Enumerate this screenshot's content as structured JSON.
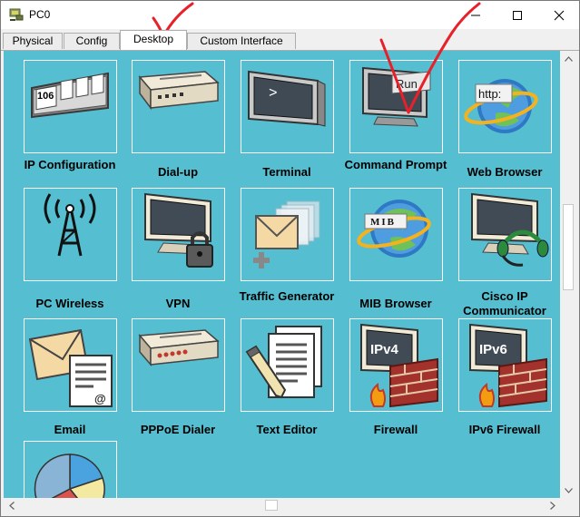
{
  "window": {
    "title": "PC0",
    "icon": "pc-device-icon",
    "controls": [
      "minimize-icon",
      "maximize-icon",
      "close-icon"
    ]
  },
  "tabs": [
    {
      "label": "Physical",
      "active": false
    },
    {
      "label": "Config",
      "active": false
    },
    {
      "label": "Desktop",
      "active": true
    },
    {
      "label": "Custom Interface",
      "active": false
    }
  ],
  "desktop": {
    "apps": [
      {
        "label": "IP Configuration",
        "icon": "ip-config-panel-icon",
        "icon_text": "106"
      },
      {
        "label": "Dial-up",
        "icon": "modem-icon"
      },
      {
        "label": "Terminal",
        "icon": "terminal-icon",
        "icon_text": ">"
      },
      {
        "label": "Command Prompt",
        "icon": "command-prompt-icon",
        "icon_text": "Run"
      },
      {
        "label": "Web Browser",
        "icon": "web-browser-icon",
        "icon_text": "http:"
      },
      {
        "label": "PC Wireless",
        "icon": "wireless-tower-icon"
      },
      {
        "label": "VPN",
        "icon": "monitor-lock-icon"
      },
      {
        "label": "Traffic Generator",
        "icon": "traffic-envelopes-icon"
      },
      {
        "label": "MIB Browser",
        "icon": "mib-globe-icon",
        "icon_text": "MIB"
      },
      {
        "label": "Cisco IP Communicator",
        "icon": "monitor-headset-icon"
      },
      {
        "label": "Email",
        "icon": "email-envelope-icon",
        "icon_text": "@"
      },
      {
        "label": "PPPoE Dialer",
        "icon": "pppoe-router-icon"
      },
      {
        "label": "Text Editor",
        "icon": "text-editor-icon"
      },
      {
        "label": "Firewall",
        "icon": "firewall-icon",
        "icon_text": "IPv4"
      },
      {
        "label": "IPv6 Firewall",
        "icon": "ipv6-firewall-icon",
        "icon_text": "IPv6"
      },
      {
        "label": "",
        "icon": "pie-chart-icon"
      }
    ]
  },
  "annotations": {
    "checkmark_color": "#e8202a",
    "icons": [
      "red-checkmark-icon",
      "red-checkmark-icon"
    ]
  },
  "colors": {
    "desktop_bg": "#55bfd1",
    "tile_border": "#ffffff",
    "checkmark": "#e8202a"
  }
}
